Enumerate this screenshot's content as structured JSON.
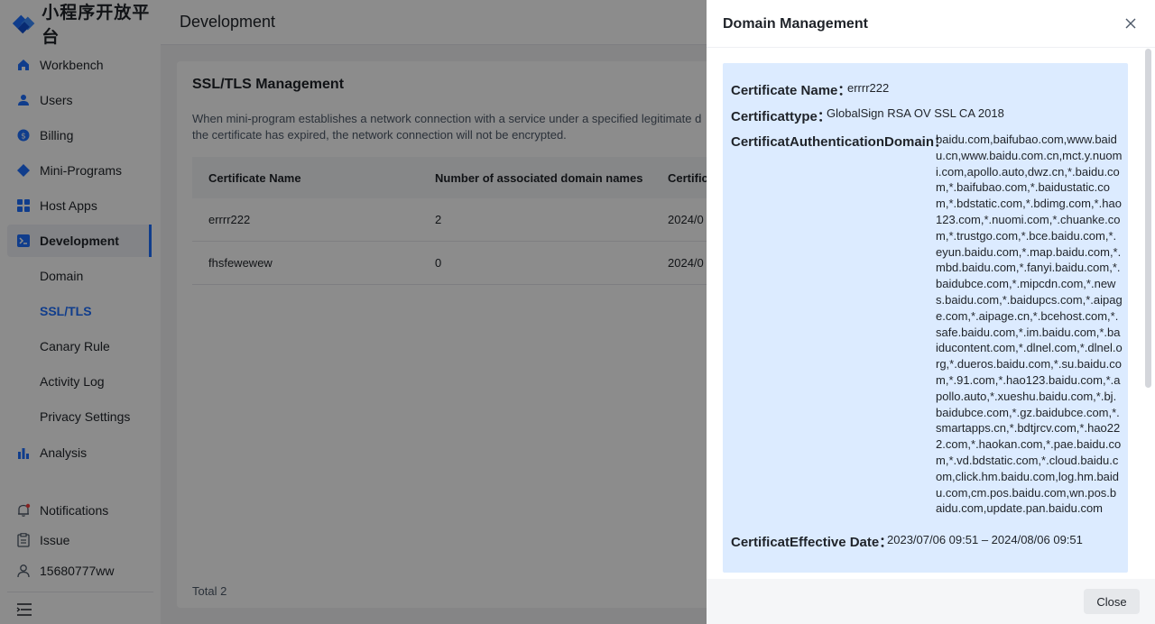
{
  "brand": {
    "name": "小程序开放平台"
  },
  "header": {
    "title": "Development"
  },
  "sidebar": {
    "items": [
      {
        "label": "Workbench",
        "icon": "home-icon"
      },
      {
        "label": "Users",
        "icon": "user-icon"
      },
      {
        "label": "Billing",
        "icon": "billing-icon"
      },
      {
        "label": "Mini-Programs",
        "icon": "mini-program-icon"
      },
      {
        "label": "Host Apps",
        "icon": "grid-icon"
      },
      {
        "label": "Development",
        "icon": "terminal-icon"
      },
      {
        "label": "Analysis",
        "icon": "bar-chart-icon"
      }
    ],
    "sub_items": [
      "Domain",
      "SSL/TLS",
      "Canary Rule",
      "Activity Log",
      "Privacy Settings"
    ],
    "bottom": {
      "notifications": "Notifications",
      "issue": "Issue",
      "account": "15680777ww"
    }
  },
  "main": {
    "title": "SSL/TLS Management",
    "description_line1": "When mini-program establishes a network connection with a service under a specified legitimate d",
    "description_line2": "the certificate has expired, the network connection will not be encrypted.",
    "table": {
      "headers": [
        "Certificate Name",
        "Number of associated domain names",
        "Certific"
      ],
      "rows": [
        [
          "errrr222",
          "2",
          "2024/0"
        ],
        [
          "fhsfewewew",
          "0",
          "2024/0"
        ]
      ]
    },
    "total": "Total 2"
  },
  "drawer": {
    "title": "Domain Management",
    "cert_name_label": "Certificate Name：",
    "cert_name_value": "errrr222",
    "cert_type_label": "Certificattype：",
    "cert_type_value": "GlobalSign RSA OV SSL CA 2018",
    "cert_domain_label": "CertificatAuthenticationDomain：",
    "cert_domain_value": "baidu.com,baifubao.com,www.baidu.cn,www.baidu.com.cn,mct.y.nuomi.com,apollo.auto,dwz.cn,*.baidu.com,*.baifubao.com,*.baidustatic.com,*.bdstatic.com,*.bdimg.com,*.hao123.com,*.nuomi.com,*.chuanke.com,*.trustgo.com,*.bce.baidu.com,*.eyun.baidu.com,*.map.baidu.com,*.mbd.baidu.com,*.fanyi.baidu.com,*.baidubce.com,*.mipcdn.com,*.news.baidu.com,*.baidupcs.com,*.aipage.com,*.aipage.cn,*.bcehost.com,*.safe.baidu.com,*.im.baidu.com,*.baiducontent.com,*.dlnel.com,*.dlnel.org,*.dueros.baidu.com,*.su.baidu.com,*.91.com,*.hao123.baidu.com,*.apollo.auto,*.xueshu.baidu.com,*.bj.baidubce.com,*.gz.baidubce.com,*.smartapps.cn,*.bdtjrcv.com,*.hao222.com,*.haokan.com,*.pae.baidu.com,*.vd.bdstatic.com,*.cloud.baidu.com,click.hm.baidu.com,log.hm.baidu.com,cm.pos.baidu.com,wn.pos.baidu.com,update.pan.baidu.com",
    "cert_date_label": "CertificatEffective Date：",
    "cert_date_value": "2023/07/06 09:51 – 2024/08/06 09:51",
    "close_label": "Close"
  }
}
